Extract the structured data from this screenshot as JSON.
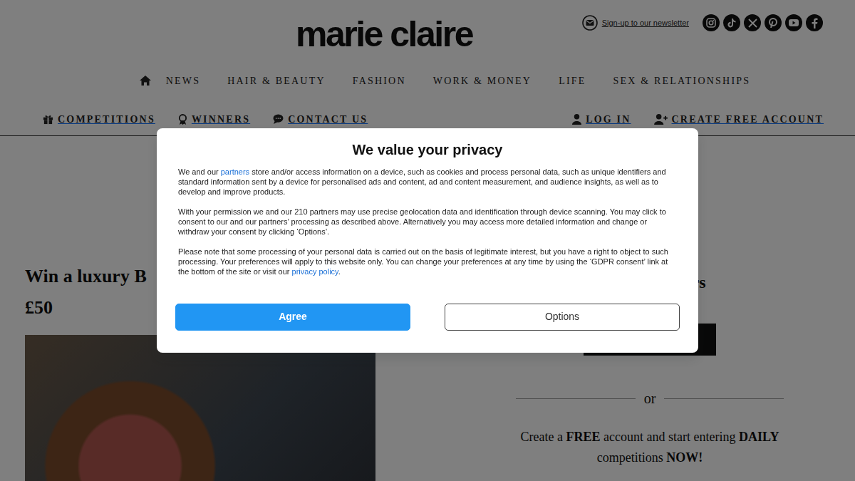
{
  "header": {
    "logo": "marie claire",
    "newsletter": "Sign-up to our newsletter"
  },
  "nav": {
    "primary": [
      "NEWS",
      "HAIR & BEAUTY",
      "FASHION",
      "WORK & MONEY",
      "LIFE",
      "SEX & RELATIONSHIPS"
    ],
    "secondary": [
      "COMPETITIONS",
      "WINNERS",
      "CONTACT US"
    ],
    "account": [
      "LOG IN",
      "CREATE FREE ACCOUNT"
    ]
  },
  "article": {
    "title": "Win a luxury B",
    "subtitle": "£50"
  },
  "sidebar": {
    "heading": "ers",
    "divider": "or",
    "promo": [
      {
        "text": "Create a ",
        "bold": false
      },
      {
        "text": "FREE",
        "bold": true
      },
      {
        "text": " account and start entering ",
        "bold": false
      },
      {
        "text": "DAILY",
        "bold": true
      },
      {
        "text": " competitions ",
        "bold": false
      },
      {
        "text": "NOW!",
        "bold": true
      }
    ]
  },
  "consent": {
    "title": "We value your privacy",
    "paragraphs": [
      [
        {
          "text": "We and our ",
          "kind": "text"
        },
        {
          "text": "partners",
          "kind": "link"
        },
        {
          "text": " store and/or access information on a device, such as cookies and process personal data, such as unique identifiers and standard information sent by a device for personalised ads and content, ad and content measurement, and audience insights, as well as to develop and improve products.",
          "kind": "text"
        }
      ],
      [
        {
          "text": "With your permission we and our 210 partners may use precise geolocation data and identification through device scanning. You may click to consent to our and our partners’ processing as described above. Alternatively you may access more detailed information and change or withdraw your consent by clicking ‘Options’.",
          "kind": "text"
        }
      ],
      [
        {
          "text": "Please note that some processing of your personal data is carried out on the basis of legitimate interest, but you have a right to object to such processing. Your preferences will apply to this website only. You can change your preferences at any time by using the ‘GDPR consent’ link at the bottom of the site or visit our ",
          "kind": "text"
        },
        {
          "text": "privacy policy",
          "kind": "link"
        },
        {
          "text": ".",
          "kind": "text"
        }
      ]
    ],
    "buttons": [
      {
        "label": "Agree",
        "kind": "primary"
      },
      {
        "label": "Options",
        "kind": "outline"
      }
    ]
  }
}
